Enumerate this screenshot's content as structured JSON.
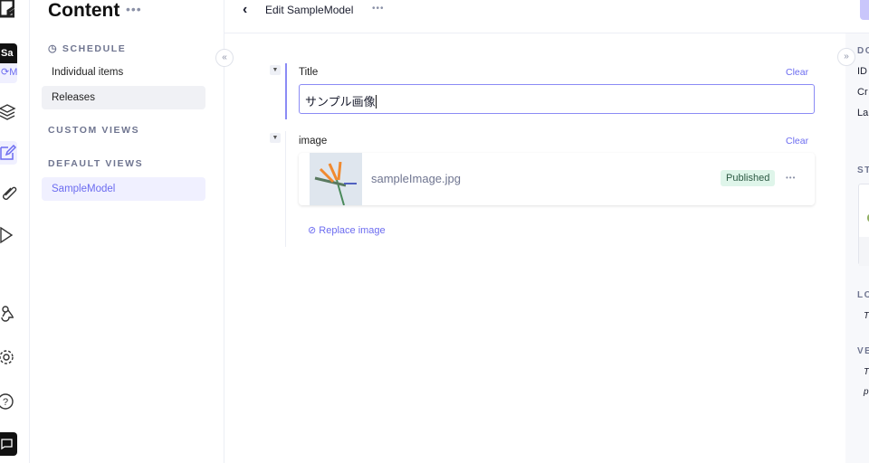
{
  "rail": {
    "project_initials": "Sa",
    "env_label": "M"
  },
  "sidebar": {
    "title": "Content",
    "more": "•••",
    "schedule_label": "SCHEDULE",
    "schedule_items": [
      {
        "label": "Individual items"
      },
      {
        "label": "Releases"
      }
    ],
    "custom_views_label": "CUSTOM VIEWS",
    "default_views_label": "DEFAULT VIEWS",
    "default_views": [
      {
        "label": "SampleModel"
      }
    ]
  },
  "header": {
    "title": "Edit SampleModel",
    "more": "•••"
  },
  "form": {
    "title_field": {
      "label": "Title",
      "clear": "Clear",
      "value": "サンプル画像"
    },
    "image_field": {
      "label": "image",
      "clear": "Clear",
      "filename": "sampleImage.jpg",
      "status": "Published",
      "more": "•••",
      "replace": "Replace image"
    }
  },
  "right_panel": {
    "section1": "DO",
    "rows": [
      "ID",
      "Cr",
      "La"
    ],
    "section2": "ST",
    "section3": "LO",
    "text3": "T",
    "section4": "VE",
    "text4a": "T",
    "text4b": "p"
  },
  "colors": {
    "accent": "#6c6cf0",
    "published_bg": "#dff5ea"
  }
}
